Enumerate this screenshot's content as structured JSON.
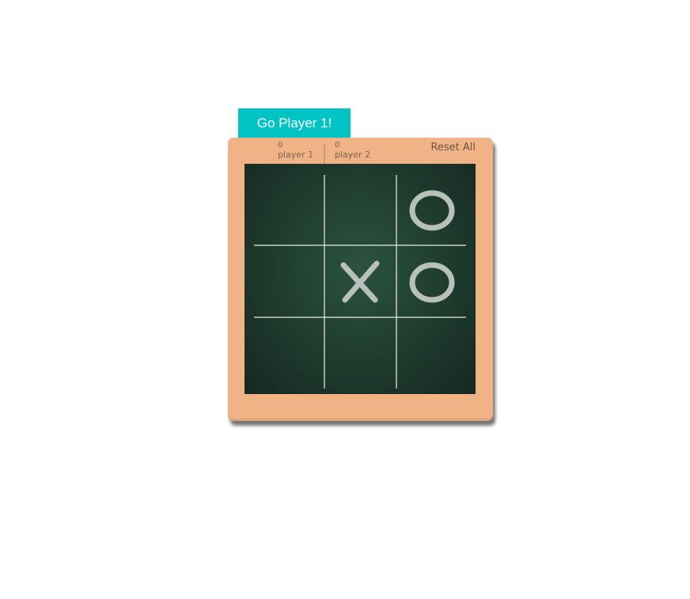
{
  "turn_banner": "Go Player 1!",
  "scores": {
    "player1": {
      "score": "0",
      "label": "player 1"
    },
    "player2": {
      "score": "0",
      "label": "player 2"
    }
  },
  "reset_label": "Reset All",
  "colors": {
    "turn_banner": "#00c4c4",
    "frame": "#f0b385",
    "board": "#1e3b2e",
    "chalk": "#b8c0bc"
  },
  "board": {
    "cells": [
      "",
      "",
      "O",
      "",
      "X",
      "O",
      "",
      "",
      ""
    ]
  }
}
